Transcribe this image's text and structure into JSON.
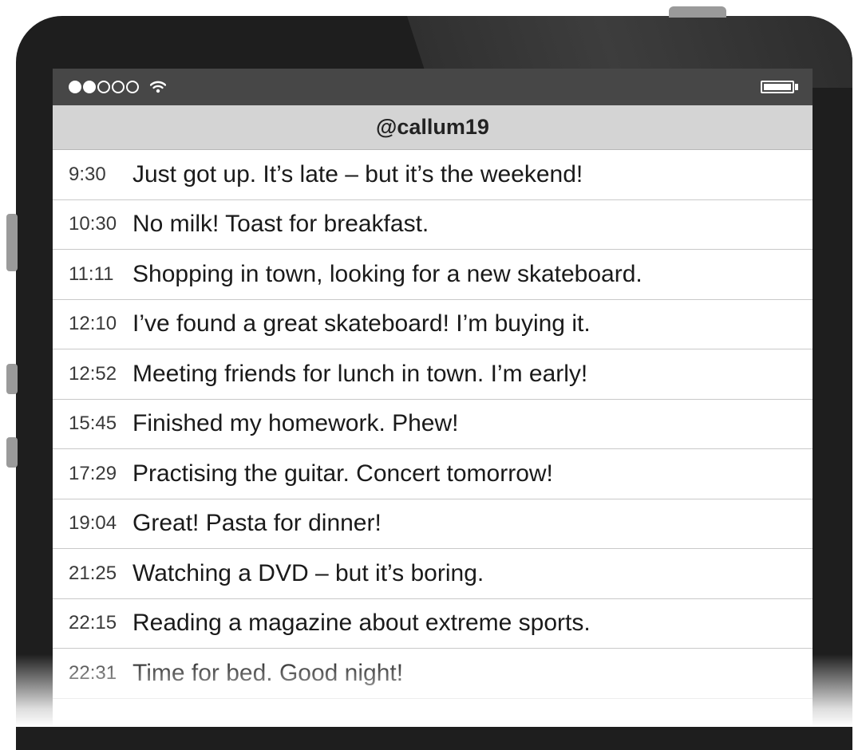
{
  "status_bar": {
    "signal_dots": [
      "full",
      "full",
      "empty",
      "empty",
      "empty"
    ],
    "wifi_icon": "wifi-icon",
    "battery_icon": "battery-icon",
    "battery_level": 1.0
  },
  "header": {
    "title": "@callum19"
  },
  "posts": [
    {
      "time": "9:30",
      "text": "Just got up. It’s late – but it’s the weekend!"
    },
    {
      "time": "10:30",
      "text": "No milk! Toast for breakfast."
    },
    {
      "time": "11:11",
      "text": "Shopping in town, looking for a new skateboard."
    },
    {
      "time": "12:10",
      "text": "I’ve found a great skateboard! I’m buying it."
    },
    {
      "time": "12:52",
      "text": "Meeting friends for lunch in town. I’m early!"
    },
    {
      "time": "15:45",
      "text": "Finished my homework. Phew!"
    },
    {
      "time": "17:29",
      "text": "Practising the guitar. Concert tomorrow!"
    },
    {
      "time": "19:04",
      "text": "Great! Pasta for dinner!"
    },
    {
      "time": "21:25",
      "text": "Watching a DVD – but it’s boring."
    },
    {
      "time": "22:15",
      "text": "Reading a magazine about extreme sports."
    },
    {
      "time": "22:31",
      "text": "Time for bed. Good night!"
    }
  ]
}
